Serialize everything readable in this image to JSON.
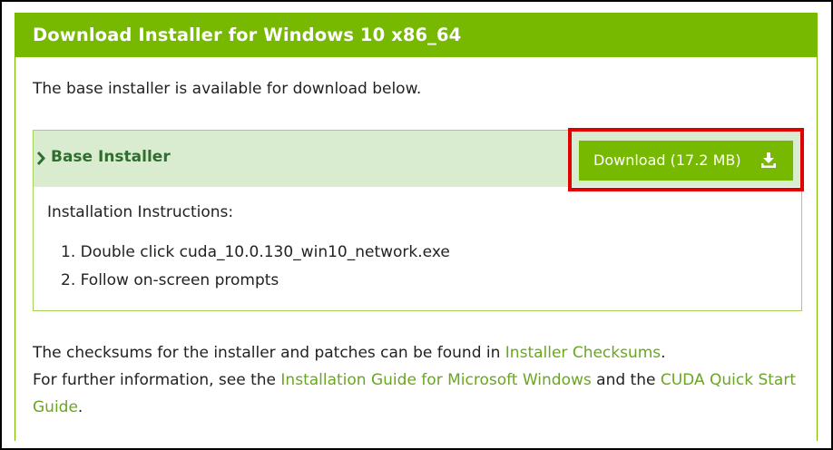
{
  "header": {
    "title": "Download Installer for Windows 10 x86_64"
  },
  "intro": "The base installer is available for download below.",
  "installer": {
    "title": "Base Installer",
    "download_label": "Download (17.2 MB)",
    "instructions_title": "Installation Instructions:",
    "steps": [
      "1. Double click cuda_10.0.130_win10_network.exe",
      "2. Follow on-screen prompts"
    ]
  },
  "footer": {
    "line1_prefix": "The checksums for the installer and patches can be found in ",
    "checksums_link": "Installer Checksums",
    "line1_suffix": ".",
    "line2_prefix": "For further information, see the ",
    "install_guide_link": "Installation Guide for Microsoft Windows",
    "line2_middle": " and the ",
    "quick_start_link": "CUDA Quick Start Guide",
    "line2_suffix": "."
  },
  "colors": {
    "accent": "#76b900",
    "header_bg_light": "#d9ecd0",
    "link": "#6aa621",
    "highlight": "#e00000"
  },
  "icons": [
    "chevron-right-icon",
    "download-icon"
  ]
}
